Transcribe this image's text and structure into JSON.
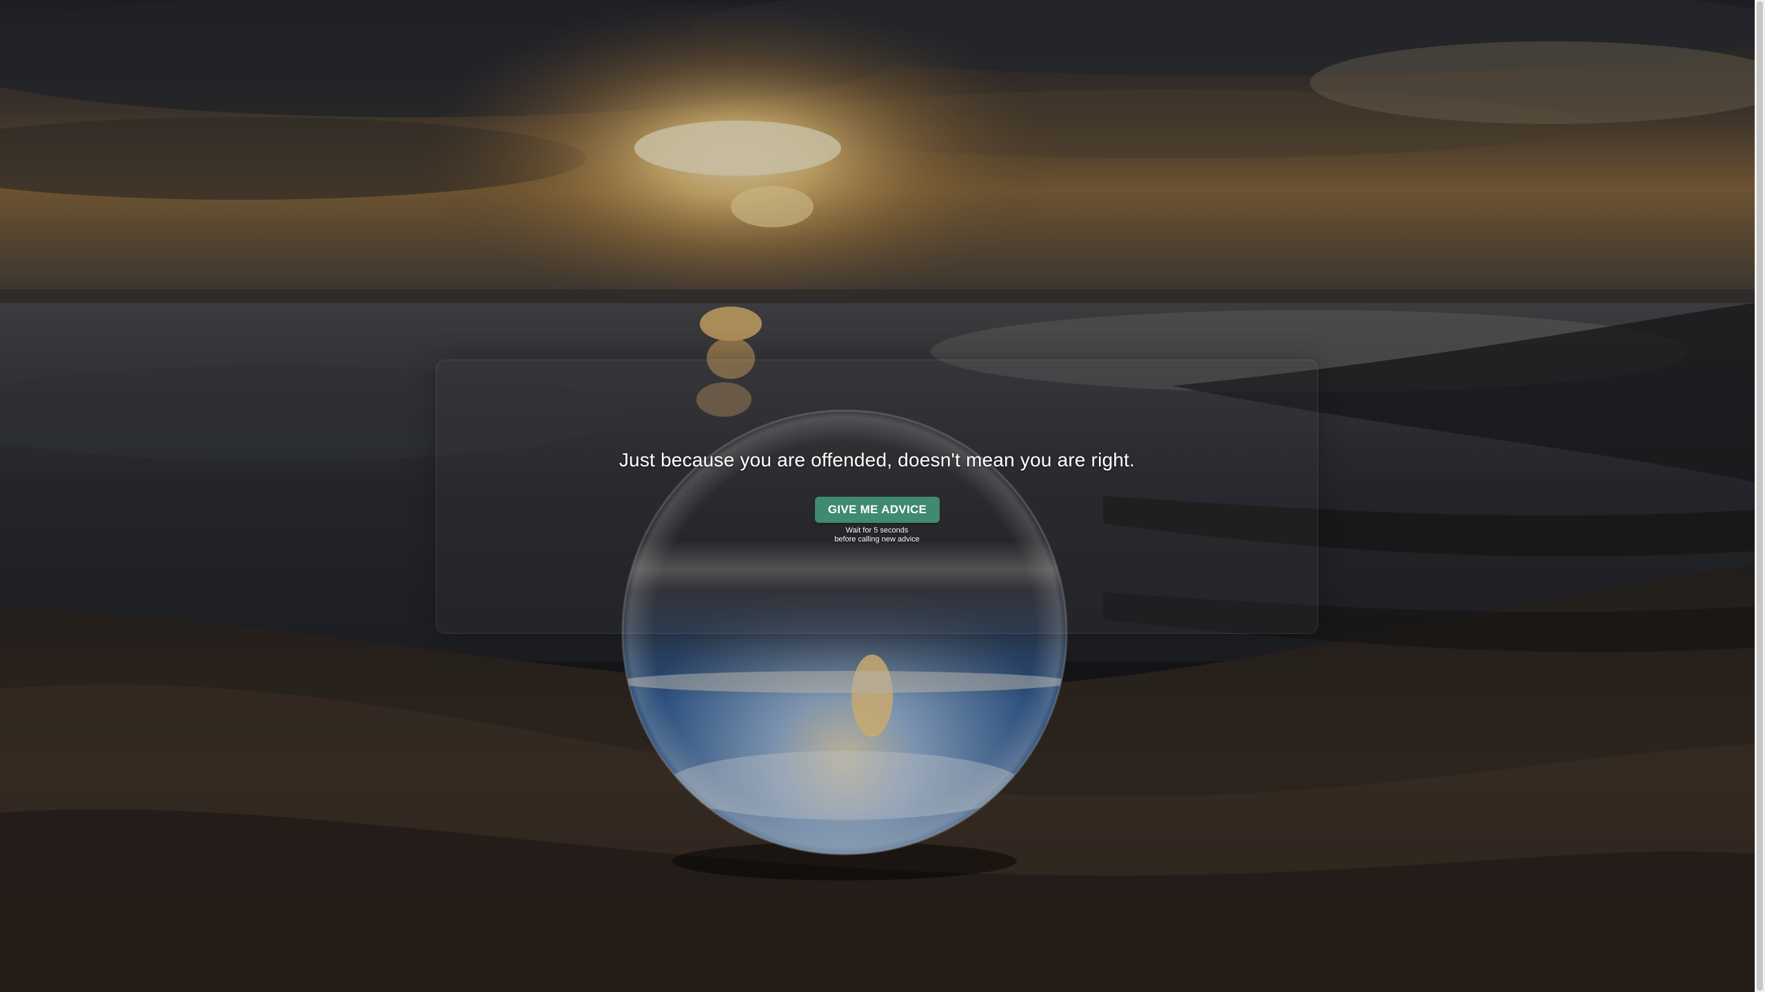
{
  "background": {
    "description_colors": {
      "sky_top": "#2b3038",
      "sun": "#f4c978",
      "sea": "#3a3f47",
      "sand": "#2a2420",
      "overlay": "#000000"
    }
  },
  "card": {
    "advice_text": "Just because you are offended, doesn't mean you are right.",
    "button_label": "GIVE ME ADVICE",
    "wait_note_line1": "Wait for 5 seconds",
    "wait_note_line2": "before calling new advice",
    "accent_color": "#3f8a70"
  }
}
